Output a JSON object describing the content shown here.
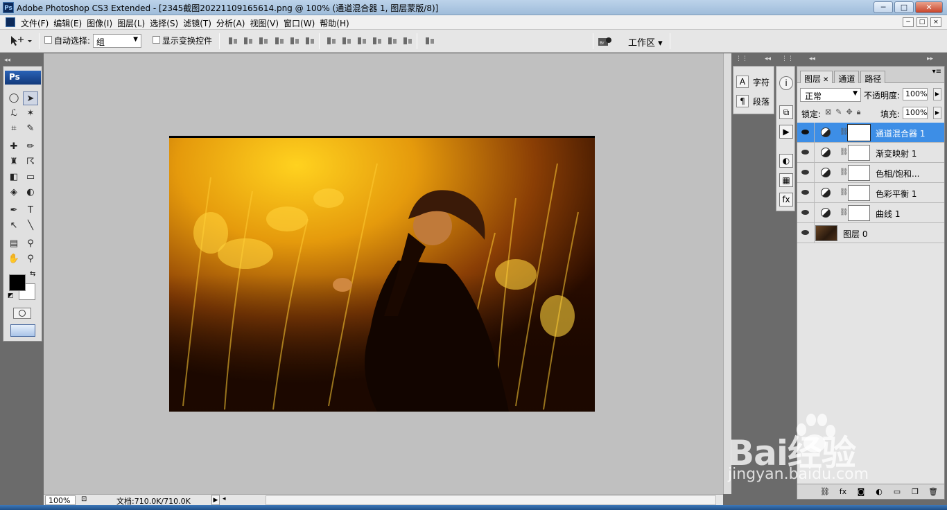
{
  "window": {
    "title": "Adobe Photoshop CS3 Extended - [2345截图20221109165614.png @ 100% (通道混合器 1, 图层蒙版/8)]",
    "app_icon": "Ps",
    "buttons": {
      "minimize": "─",
      "maximize": "□",
      "close": "✕"
    }
  },
  "menu": {
    "items": [
      "文件(F)",
      "编辑(E)",
      "图像(I)",
      "图层(L)",
      "选择(S)",
      "滤镜(T)",
      "分析(A)",
      "视图(V)",
      "窗口(W)",
      "帮助(H)"
    ],
    "mdi_buttons": [
      "−",
      "□",
      "×"
    ]
  },
  "options": {
    "auto_select_label": "自动选择:",
    "auto_select_value": "组",
    "show_transform_label": "显示变换控件",
    "workspace_label": "工作区 ▾"
  },
  "toolbox": {
    "header": "Ps"
  },
  "status": {
    "zoom": "100%",
    "doc_info": "文档:710.0K/710.0K"
  },
  "side_panels": {
    "character_label": "字符",
    "paragraph_label": "段落"
  },
  "layers_panel": {
    "tabs": [
      "图层",
      "通道",
      "路径"
    ],
    "blend_mode": "正常",
    "opacity_label": "不透明度:",
    "opacity_value": "100%",
    "lock_label": "锁定:",
    "fill_label": "填充:",
    "fill_value": "100%",
    "layers": [
      {
        "name": "通道混合器 1",
        "selected": true
      },
      {
        "name": "渐变映射 1",
        "selected": false
      },
      {
        "name": "色相/饱和...",
        "selected": false
      },
      {
        "name": "色彩平衡 1",
        "selected": false
      },
      {
        "name": "曲线 1",
        "selected": false
      },
      {
        "name": "图层 0",
        "selected": false
      }
    ]
  },
  "watermark": {
    "brand": "Bai经验",
    "url": "jingyan.baidu.com"
  },
  "colors": {
    "selected_layer": "#3d8ee6",
    "workspace_bg": "#c0c0c0",
    "photo_tone": "#e0a010"
  }
}
